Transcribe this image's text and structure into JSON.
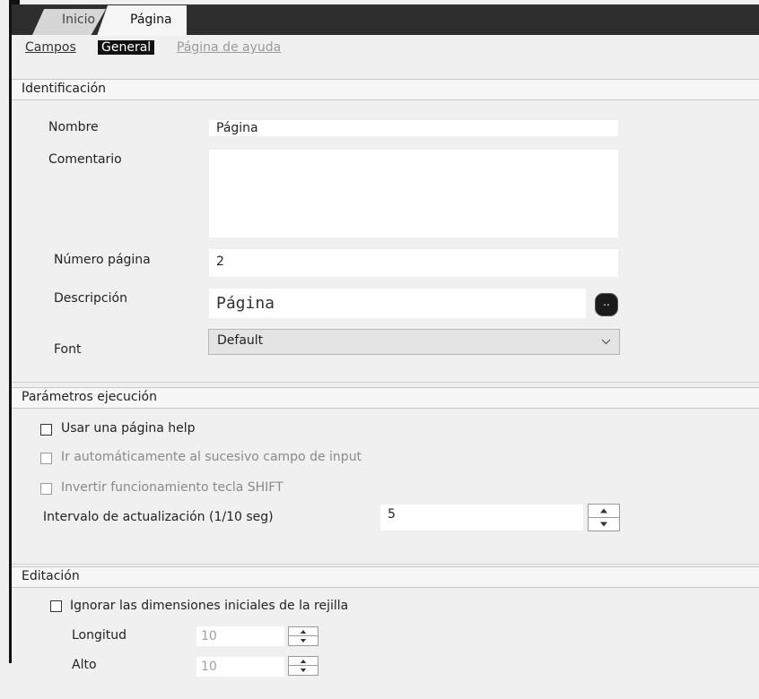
{
  "tabs": [
    {
      "label": "Inicio"
    },
    {
      "label": "Página"
    }
  ],
  "subnav": {
    "campos": "Campos",
    "general": "General",
    "ayuda": "Página de ayuda"
  },
  "identificacion": {
    "title": "Identificación",
    "nombre_label": "Nombre",
    "nombre_value": "Página",
    "comentario_label": "Comentario",
    "comentario_value": "",
    "numero_label": "Número página",
    "numero_value": "2",
    "descripcion_label": "Descripción",
    "descripcion_value": "Página",
    "descripcion_button": "..",
    "font_label": "Font",
    "font_value": "Default"
  },
  "parametros": {
    "title": "Parámetros ejecución",
    "usar_help": "Usar una página help",
    "ir_auto": "Ir automáticamente al sucesivo campo de input",
    "invertir": "Invertir funcionamiento tecla SHIFT",
    "intervalo_label": "Intervalo de actualización (1/10 seg)",
    "intervalo_value": "5"
  },
  "editacion": {
    "title": "Editación",
    "ignorar": "Ignorar las dimensiones iniciales de la rejilla",
    "longitud_label": "Longitud",
    "longitud_value": "10",
    "alto_label": "Alto",
    "alto_value": "10"
  },
  "icons": {
    "dropdown": "chevron-down-icon",
    "spin_up": "arrow-up-icon",
    "spin_down": "arrow-down-icon",
    "ellipsis": "ellipsis-icon"
  },
  "colors": {
    "tabbar": "#2e2e2e",
    "active_subnav": "#111111",
    "background": "#f0f0f0"
  }
}
